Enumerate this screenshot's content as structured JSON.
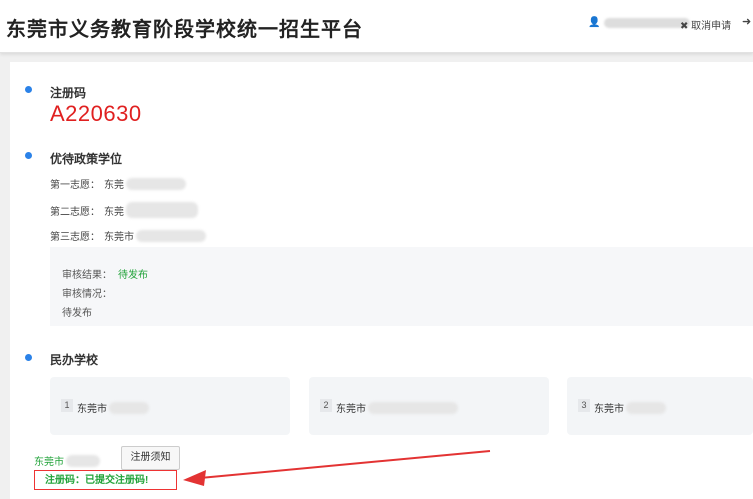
{
  "header": {
    "title": "东莞市义务教育阶段学校统一招生平台",
    "cancel_label": "✖ 取消申请",
    "logout_label": "➜"
  },
  "registration": {
    "label": "注册码",
    "code": "A220630"
  },
  "policy": {
    "label": "优待政策学位",
    "wishes": [
      {
        "label": "第一志愿：",
        "school": "东莞"
      },
      {
        "label": "第二志愿：",
        "school": "东莞"
      },
      {
        "label": "第三志愿：",
        "school": "东莞市"
      }
    ],
    "review": {
      "result_label": "审核结果：",
      "result_value": "待发布",
      "situation_label": "审核情况：",
      "situation_value": "待发布"
    }
  },
  "private": {
    "label": "民办学校",
    "schools": [
      {
        "num": "1",
        "name": "东莞市"
      },
      {
        "num": "2",
        "name": "东莞市"
      },
      {
        "num": "3",
        "name": "东莞市"
      }
    ]
  },
  "bottom": {
    "school": "东莞市",
    "notice_button": "注册须知",
    "status": "注册码：已提交注册码!"
  },
  "colors": {
    "accent_dot": "#2b82e8",
    "code_red": "#e02020",
    "status_green": "#22a33a",
    "highlight_red": "#e33333"
  }
}
